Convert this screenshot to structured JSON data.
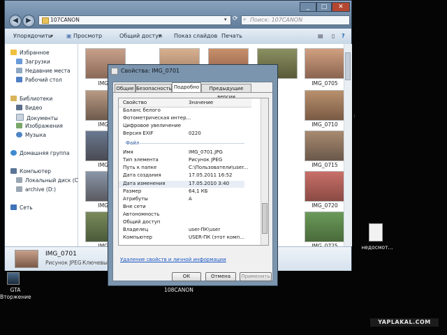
{
  "explorer": {
    "address_path": "107CANON",
    "search_placeholder": "Поиск: 107CANON",
    "toolbar": [
      "Упорядочить",
      "Просмотр",
      "Общий доступ",
      "Показ слайдов",
      "Печать"
    ],
    "nav": {
      "favorites": "Избранное",
      "downloads": "Загрузки",
      "recent": "Недавние места",
      "desktop": "Рабочий стол",
      "libraries": "Библиотеки",
      "video": "Видео",
      "documents": "Документы",
      "images": "Изображения",
      "music": "Музыка",
      "homegroup": "Домашняя группа",
      "computer": "Компьютер",
      "local_disk": "Локальный диск (С",
      "archive": "archive (D:)",
      "network": "Сеть"
    },
    "thumb_labels": {
      "r0c0": "IMG_0",
      "r0c4": "IMG_0705",
      "r1c0": "IMG_0",
      "r1c4": "IMG_0710",
      "r2c0": "IMG_0",
      "r2c4": "IMG_0715",
      "r3c0": "IMG_0",
      "r3c4": "IMG_0720",
      "r4c0": "IMG_0",
      "r4c4": "IMG_0725"
    },
    "details": {
      "name": "IMG_0701",
      "type": "Рисунок JPEG",
      "tags_label": "Ключевые"
    }
  },
  "dialog": {
    "title": "Свойства: IMG_0701",
    "tabs": [
      "Общие",
      "Безопасность",
      "Подробно",
      "Предыдущие версии"
    ],
    "active_tab": "Подробно",
    "header_property": "Свойство",
    "header_value": "Значение",
    "top_rows": [
      {
        "name": "Баланс белого",
        "value": ""
      },
      {
        "name": "Фотометрическая интер...",
        "value": ""
      },
      {
        "name": "Цифровое увеличение",
        "value": ""
      },
      {
        "name": "Версия EXIF",
        "value": "0220"
      }
    ],
    "section_file": "Файл",
    "file_rows": [
      {
        "name": "Имя",
        "value": "IMG_0701.JPG"
      },
      {
        "name": "Тип элемента",
        "value": "Рисунок JPEG"
      },
      {
        "name": "Путь к папке",
        "value": "C:\\Пользователи\\user..."
      },
      {
        "name": "Дата создания",
        "value": "17.05.2011 16:52"
      },
      {
        "name": "Дата изменения",
        "value": "17.05.2010 3:40"
      },
      {
        "name": "Размер",
        "value": "64,1 КБ"
      },
      {
        "name": "Атрибуты",
        "value": "A"
      },
      {
        "name": "Вне сети",
        "value": ""
      },
      {
        "name": "Автономность",
        "value": ""
      },
      {
        "name": "Общий доступ",
        "value": ""
      },
      {
        "name": "Владелец",
        "value": "user-ПК\\user"
      },
      {
        "name": "Компьютер",
        "value": "USER-ПК (этот комп..."
      }
    ],
    "remove_link": "Удаление свойств и личной информации",
    "buttons": {
      "ok": "ОК",
      "cancel": "Отмена",
      "apply": "Применить"
    }
  },
  "desktop": {
    "gta_line1": "GTA",
    "gta_line2": "Вторжение",
    "folder_label": "108CANON",
    "file_label": "недосмот...",
    "watermark": "YAPLAKAL.COM"
  },
  "colors": {
    "accent": "#3366cc",
    "link": "#1a56c4",
    "selected_row": "#e8eef6"
  }
}
